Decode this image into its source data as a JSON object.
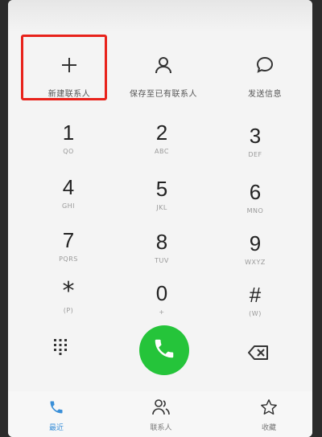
{
  "actions": {
    "new_contact": "新建联系人",
    "save_existing": "保存至已有联系人",
    "send_message": "发送信息"
  },
  "keypad": [
    {
      "digit": "1",
      "letters": "QO"
    },
    {
      "digit": "2",
      "letters": "ABC"
    },
    {
      "digit": "3",
      "letters": "DEF"
    },
    {
      "digit": "4",
      "letters": "GHI"
    },
    {
      "digit": "5",
      "letters": "JKL"
    },
    {
      "digit": "6",
      "letters": "MNO"
    },
    {
      "digit": "7",
      "letters": "PQRS"
    },
    {
      "digit": "8",
      "letters": "TUV"
    },
    {
      "digit": "9",
      "letters": "WXYZ"
    },
    {
      "digit": "*",
      "letters": "(P)"
    },
    {
      "digit": "0",
      "letters": "+"
    },
    {
      "digit": "#",
      "letters": "(W)"
    }
  ],
  "nav": {
    "recent": "最近",
    "contacts": "联系人",
    "favorites": "收藏"
  },
  "colors": {
    "call_button": "#25c43a",
    "highlight_box": "#e8221b",
    "active_tab": "#3a8fd8"
  },
  "icons": [
    "plus-icon",
    "person-icon",
    "chat-bubble-icon",
    "dialpad-grid-icon",
    "phone-icon",
    "backspace-icon",
    "star-icon"
  ]
}
